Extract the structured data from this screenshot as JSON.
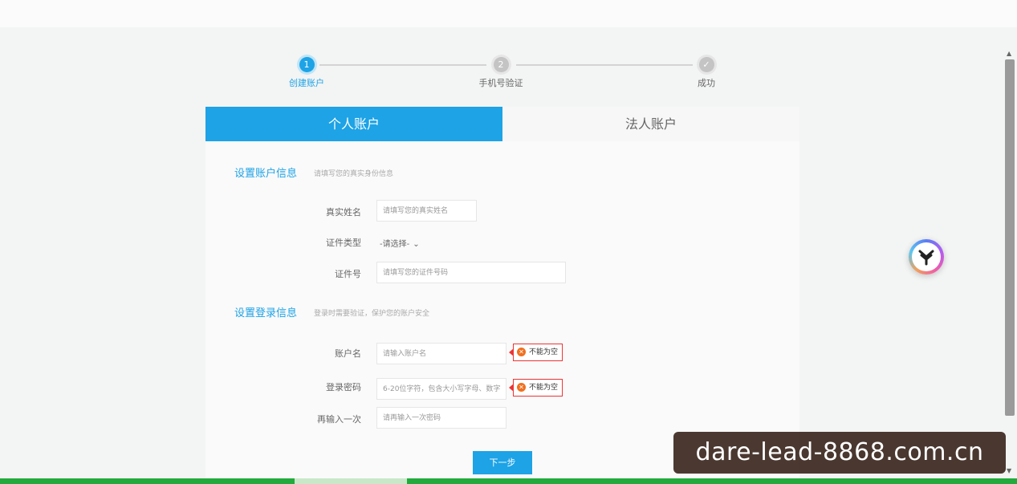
{
  "steps": [
    {
      "number": "1",
      "label": "创建账户"
    },
    {
      "number": "2",
      "label": "手机号验证"
    },
    {
      "number": "✓",
      "label": "成功"
    }
  ],
  "tabs": {
    "personal": "个人账户",
    "corporate": "法人账户"
  },
  "account_info": {
    "title": "设置账户信息",
    "subtitle": "请填写您的真实身份信息",
    "name_label": "真实姓名",
    "name_placeholder": "请填写您的真实姓名",
    "id_type_label": "证件类型",
    "id_type_value": "-请选择-",
    "id_number_label": "证件号",
    "id_number_placeholder": "请填写您的证件号码"
  },
  "login_info": {
    "title": "设置登录信息",
    "subtitle": "登录时需要验证，保护您的账户安全",
    "username_label": "账户名",
    "username_placeholder": "请输入账户名",
    "username_error": "不能为空",
    "password_label": "登录密码",
    "password_placeholder": "6-20位字符，包含大小写字母、数字",
    "password_error": "不能为空",
    "confirm_label": "再输入一次",
    "confirm_placeholder": "请再输入一次密码"
  },
  "next_button": "下一步",
  "watermark": "dare-lead-8868.com.cn",
  "colors": {
    "accent": "#1da3e6",
    "error": "#e33333"
  },
  "icons": {
    "error": "x-circle-icon",
    "select": "chevron-down-icon",
    "float": "app-logo-icon"
  }
}
